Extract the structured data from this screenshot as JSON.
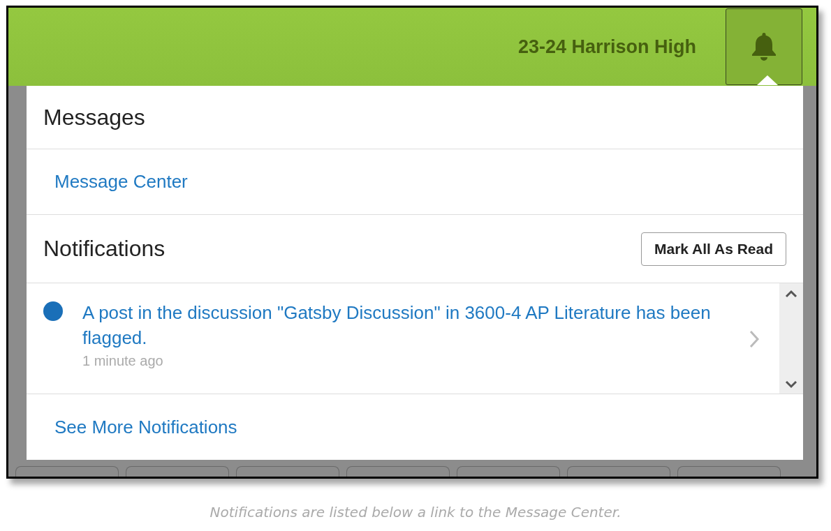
{
  "header": {
    "school": "23-24 Harrison High"
  },
  "messages": {
    "title": "Messages",
    "link": "Message Center"
  },
  "notifications": {
    "title": "Notifications",
    "mark_all_button": "Mark All As Read",
    "items": [
      {
        "text": "A post in the discussion \"Gatsby Discussion\" in 3600-4 AP Literature has been flagged.",
        "time": "1 minute ago",
        "unread": true
      }
    ],
    "see_more": "See More Notifications"
  },
  "caption": "Notifications are listed below a link to the Message Center."
}
